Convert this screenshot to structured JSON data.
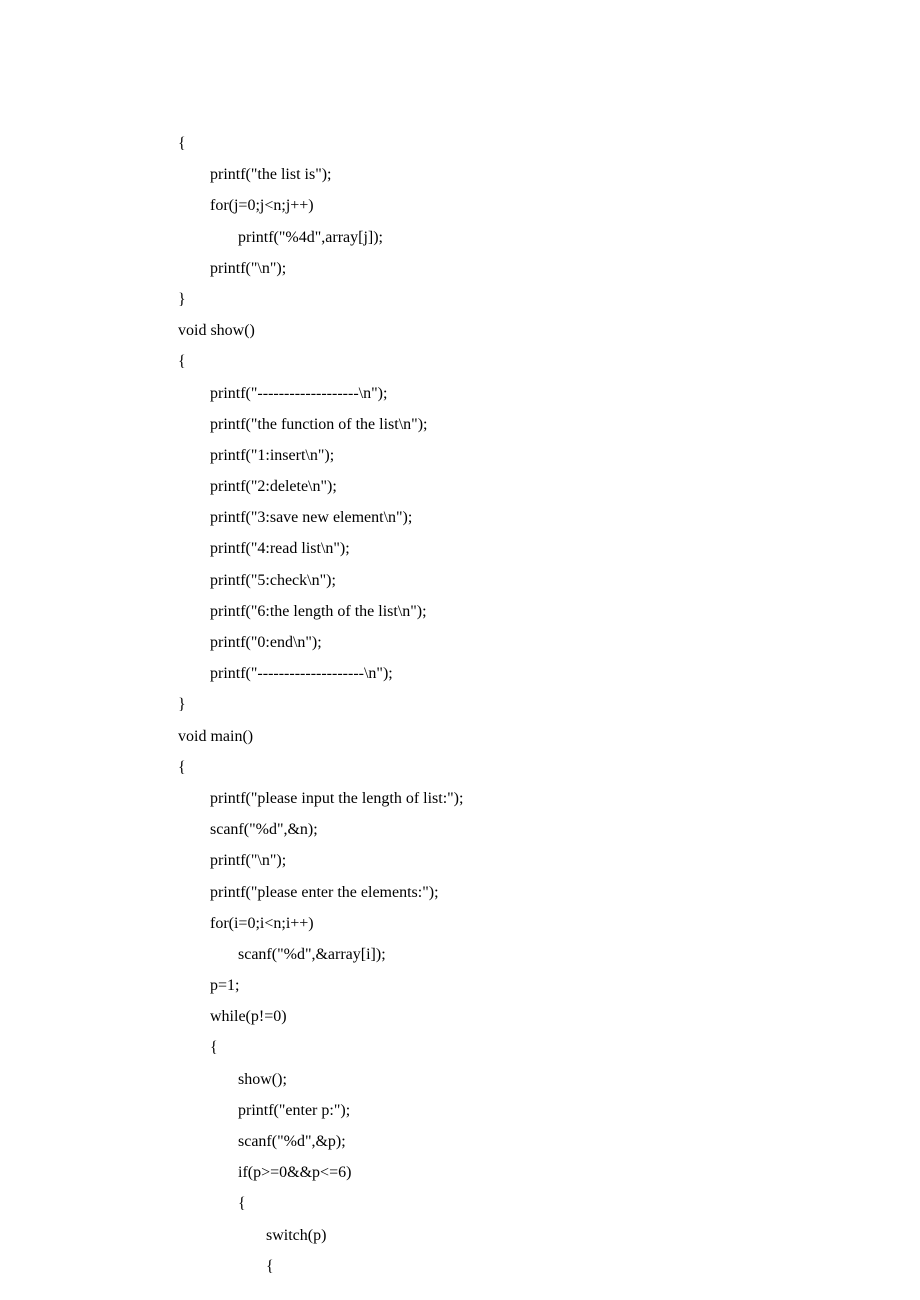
{
  "code_lines": [
    "{",
    "        printf(\"the list is\");",
    "        for(j=0;j<n;j++)",
    "               printf(\"%4d\",array[j]);",
    "        printf(\"\\n\");",
    "}",
    "void show()",
    "{",
    "        printf(\"-------------------\\n\");",
    "        printf(\"the function of the list\\n\");",
    "        printf(\"1:insert\\n\");",
    "        printf(\"2:delete\\n\");",
    "        printf(\"3:save new element\\n\");",
    "        printf(\"4:read list\\n\");",
    "        printf(\"5:check\\n\");",
    "        printf(\"6:the length of the list\\n\");",
    "        printf(\"0:end\\n\");",
    "        printf(\"--------------------\\n\");",
    "}",
    "void main()",
    "{",
    "        printf(\"please input the length of list:\");",
    "        scanf(\"%d\",&n);",
    "        printf(\"\\n\");",
    "        printf(\"please enter the elements:\");",
    "        for(i=0;i<n;i++)",
    "               scanf(\"%d\",&array[i]);",
    "        p=1;",
    "        while(p!=0)",
    "        {",
    "               show();",
    "               printf(\"enter p:\");",
    "               scanf(\"%d\",&p);",
    "               if(p>=0&&p<=6)",
    "               {",
    "                      switch(p)",
    "                      {"
  ]
}
